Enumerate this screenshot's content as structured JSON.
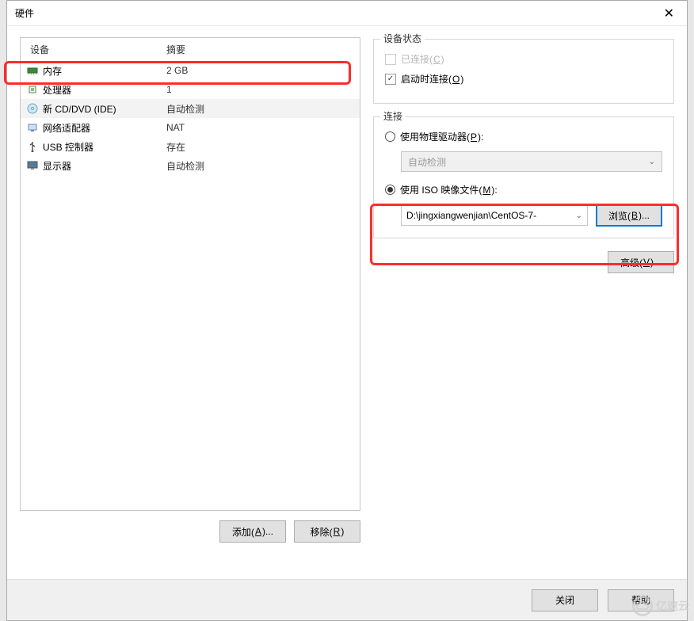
{
  "window": {
    "title": "硬件"
  },
  "deviceList": {
    "headers": {
      "device": "设备",
      "summary": "摘要"
    },
    "items": [
      {
        "name": "内存",
        "summary": "2 GB",
        "icon": "memory-icon"
      },
      {
        "name": "处理器",
        "summary": "1",
        "icon": "cpu-icon"
      },
      {
        "name": "新 CD/DVD (IDE)",
        "summary": "自动检测",
        "icon": "cd-icon",
        "selected": true
      },
      {
        "name": "网络适配器",
        "summary": "NAT",
        "icon": "network-icon"
      },
      {
        "name": "USB 控制器",
        "summary": "存在",
        "icon": "usb-icon"
      },
      {
        "name": "显示器",
        "summary": "自动检测",
        "icon": "display-icon"
      }
    ]
  },
  "buttons": {
    "add": "添加(A)...",
    "remove": "移除(R)",
    "browse": "浏览(B)...",
    "advanced": "高级(V)...",
    "close": "关闭",
    "help": "帮助"
  },
  "deviceStatus": {
    "legend": "设备状态",
    "connected": "已连接(C)",
    "connectOnStart": "启动时连接(O)"
  },
  "connection": {
    "legend": "连接",
    "usePhysical": "使用物理驱动器(P):",
    "autoDetect": "自动检测",
    "useIso": "使用 ISO 映像文件(M):",
    "isoPath": "D:\\jingxiangwenjian\\CentOS-7-"
  },
  "watermark": "亿速云"
}
